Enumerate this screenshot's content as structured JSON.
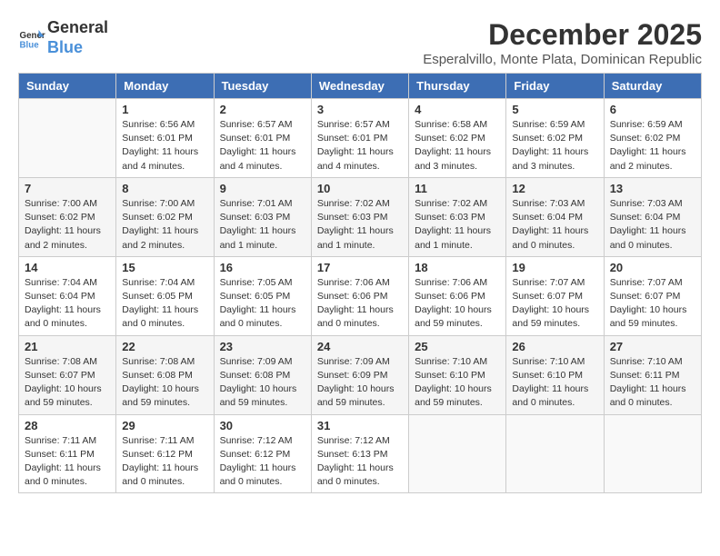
{
  "header": {
    "logo_line1": "General",
    "logo_line2": "Blue",
    "month": "December 2025",
    "location": "Esperalvillo, Monte Plata, Dominican Republic"
  },
  "days_of_week": [
    "Sunday",
    "Monday",
    "Tuesday",
    "Wednesday",
    "Thursday",
    "Friday",
    "Saturday"
  ],
  "weeks": [
    [
      {
        "day": "",
        "info": ""
      },
      {
        "day": "1",
        "info": "Sunrise: 6:56 AM\nSunset: 6:01 PM\nDaylight: 11 hours\nand 4 minutes."
      },
      {
        "day": "2",
        "info": "Sunrise: 6:57 AM\nSunset: 6:01 PM\nDaylight: 11 hours\nand 4 minutes."
      },
      {
        "day": "3",
        "info": "Sunrise: 6:57 AM\nSunset: 6:01 PM\nDaylight: 11 hours\nand 4 minutes."
      },
      {
        "day": "4",
        "info": "Sunrise: 6:58 AM\nSunset: 6:02 PM\nDaylight: 11 hours\nand 3 minutes."
      },
      {
        "day": "5",
        "info": "Sunrise: 6:59 AM\nSunset: 6:02 PM\nDaylight: 11 hours\nand 3 minutes."
      },
      {
        "day": "6",
        "info": "Sunrise: 6:59 AM\nSunset: 6:02 PM\nDaylight: 11 hours\nand 2 minutes."
      }
    ],
    [
      {
        "day": "7",
        "info": "Sunrise: 7:00 AM\nSunset: 6:02 PM\nDaylight: 11 hours\nand 2 minutes."
      },
      {
        "day": "8",
        "info": "Sunrise: 7:00 AM\nSunset: 6:02 PM\nDaylight: 11 hours\nand 2 minutes."
      },
      {
        "day": "9",
        "info": "Sunrise: 7:01 AM\nSunset: 6:03 PM\nDaylight: 11 hours\nand 1 minute."
      },
      {
        "day": "10",
        "info": "Sunrise: 7:02 AM\nSunset: 6:03 PM\nDaylight: 11 hours\nand 1 minute."
      },
      {
        "day": "11",
        "info": "Sunrise: 7:02 AM\nSunset: 6:03 PM\nDaylight: 11 hours\nand 1 minute."
      },
      {
        "day": "12",
        "info": "Sunrise: 7:03 AM\nSunset: 6:04 PM\nDaylight: 11 hours\nand 0 minutes."
      },
      {
        "day": "13",
        "info": "Sunrise: 7:03 AM\nSunset: 6:04 PM\nDaylight: 11 hours\nand 0 minutes."
      }
    ],
    [
      {
        "day": "14",
        "info": "Sunrise: 7:04 AM\nSunset: 6:04 PM\nDaylight: 11 hours\nand 0 minutes."
      },
      {
        "day": "15",
        "info": "Sunrise: 7:04 AM\nSunset: 6:05 PM\nDaylight: 11 hours\nand 0 minutes."
      },
      {
        "day": "16",
        "info": "Sunrise: 7:05 AM\nSunset: 6:05 PM\nDaylight: 11 hours\nand 0 minutes."
      },
      {
        "day": "17",
        "info": "Sunrise: 7:06 AM\nSunset: 6:06 PM\nDaylight: 11 hours\nand 0 minutes."
      },
      {
        "day": "18",
        "info": "Sunrise: 7:06 AM\nSunset: 6:06 PM\nDaylight: 10 hours\nand 59 minutes."
      },
      {
        "day": "19",
        "info": "Sunrise: 7:07 AM\nSunset: 6:07 PM\nDaylight: 10 hours\nand 59 minutes."
      },
      {
        "day": "20",
        "info": "Sunrise: 7:07 AM\nSunset: 6:07 PM\nDaylight: 10 hours\nand 59 minutes."
      }
    ],
    [
      {
        "day": "21",
        "info": "Sunrise: 7:08 AM\nSunset: 6:07 PM\nDaylight: 10 hours\nand 59 minutes."
      },
      {
        "day": "22",
        "info": "Sunrise: 7:08 AM\nSunset: 6:08 PM\nDaylight: 10 hours\nand 59 minutes."
      },
      {
        "day": "23",
        "info": "Sunrise: 7:09 AM\nSunset: 6:08 PM\nDaylight: 10 hours\nand 59 minutes."
      },
      {
        "day": "24",
        "info": "Sunrise: 7:09 AM\nSunset: 6:09 PM\nDaylight: 10 hours\nand 59 minutes."
      },
      {
        "day": "25",
        "info": "Sunrise: 7:10 AM\nSunset: 6:10 PM\nDaylight: 10 hours\nand 59 minutes."
      },
      {
        "day": "26",
        "info": "Sunrise: 7:10 AM\nSunset: 6:10 PM\nDaylight: 11 hours\nand 0 minutes."
      },
      {
        "day": "27",
        "info": "Sunrise: 7:10 AM\nSunset: 6:11 PM\nDaylight: 11 hours\nand 0 minutes."
      }
    ],
    [
      {
        "day": "28",
        "info": "Sunrise: 7:11 AM\nSunset: 6:11 PM\nDaylight: 11 hours\nand 0 minutes."
      },
      {
        "day": "29",
        "info": "Sunrise: 7:11 AM\nSunset: 6:12 PM\nDaylight: 11 hours\nand 0 minutes."
      },
      {
        "day": "30",
        "info": "Sunrise: 7:12 AM\nSunset: 6:12 PM\nDaylight: 11 hours\nand 0 minutes."
      },
      {
        "day": "31",
        "info": "Sunrise: 7:12 AM\nSunset: 6:13 PM\nDaylight: 11 hours\nand 0 minutes."
      },
      {
        "day": "",
        "info": ""
      },
      {
        "day": "",
        "info": ""
      },
      {
        "day": "",
        "info": ""
      }
    ]
  ]
}
